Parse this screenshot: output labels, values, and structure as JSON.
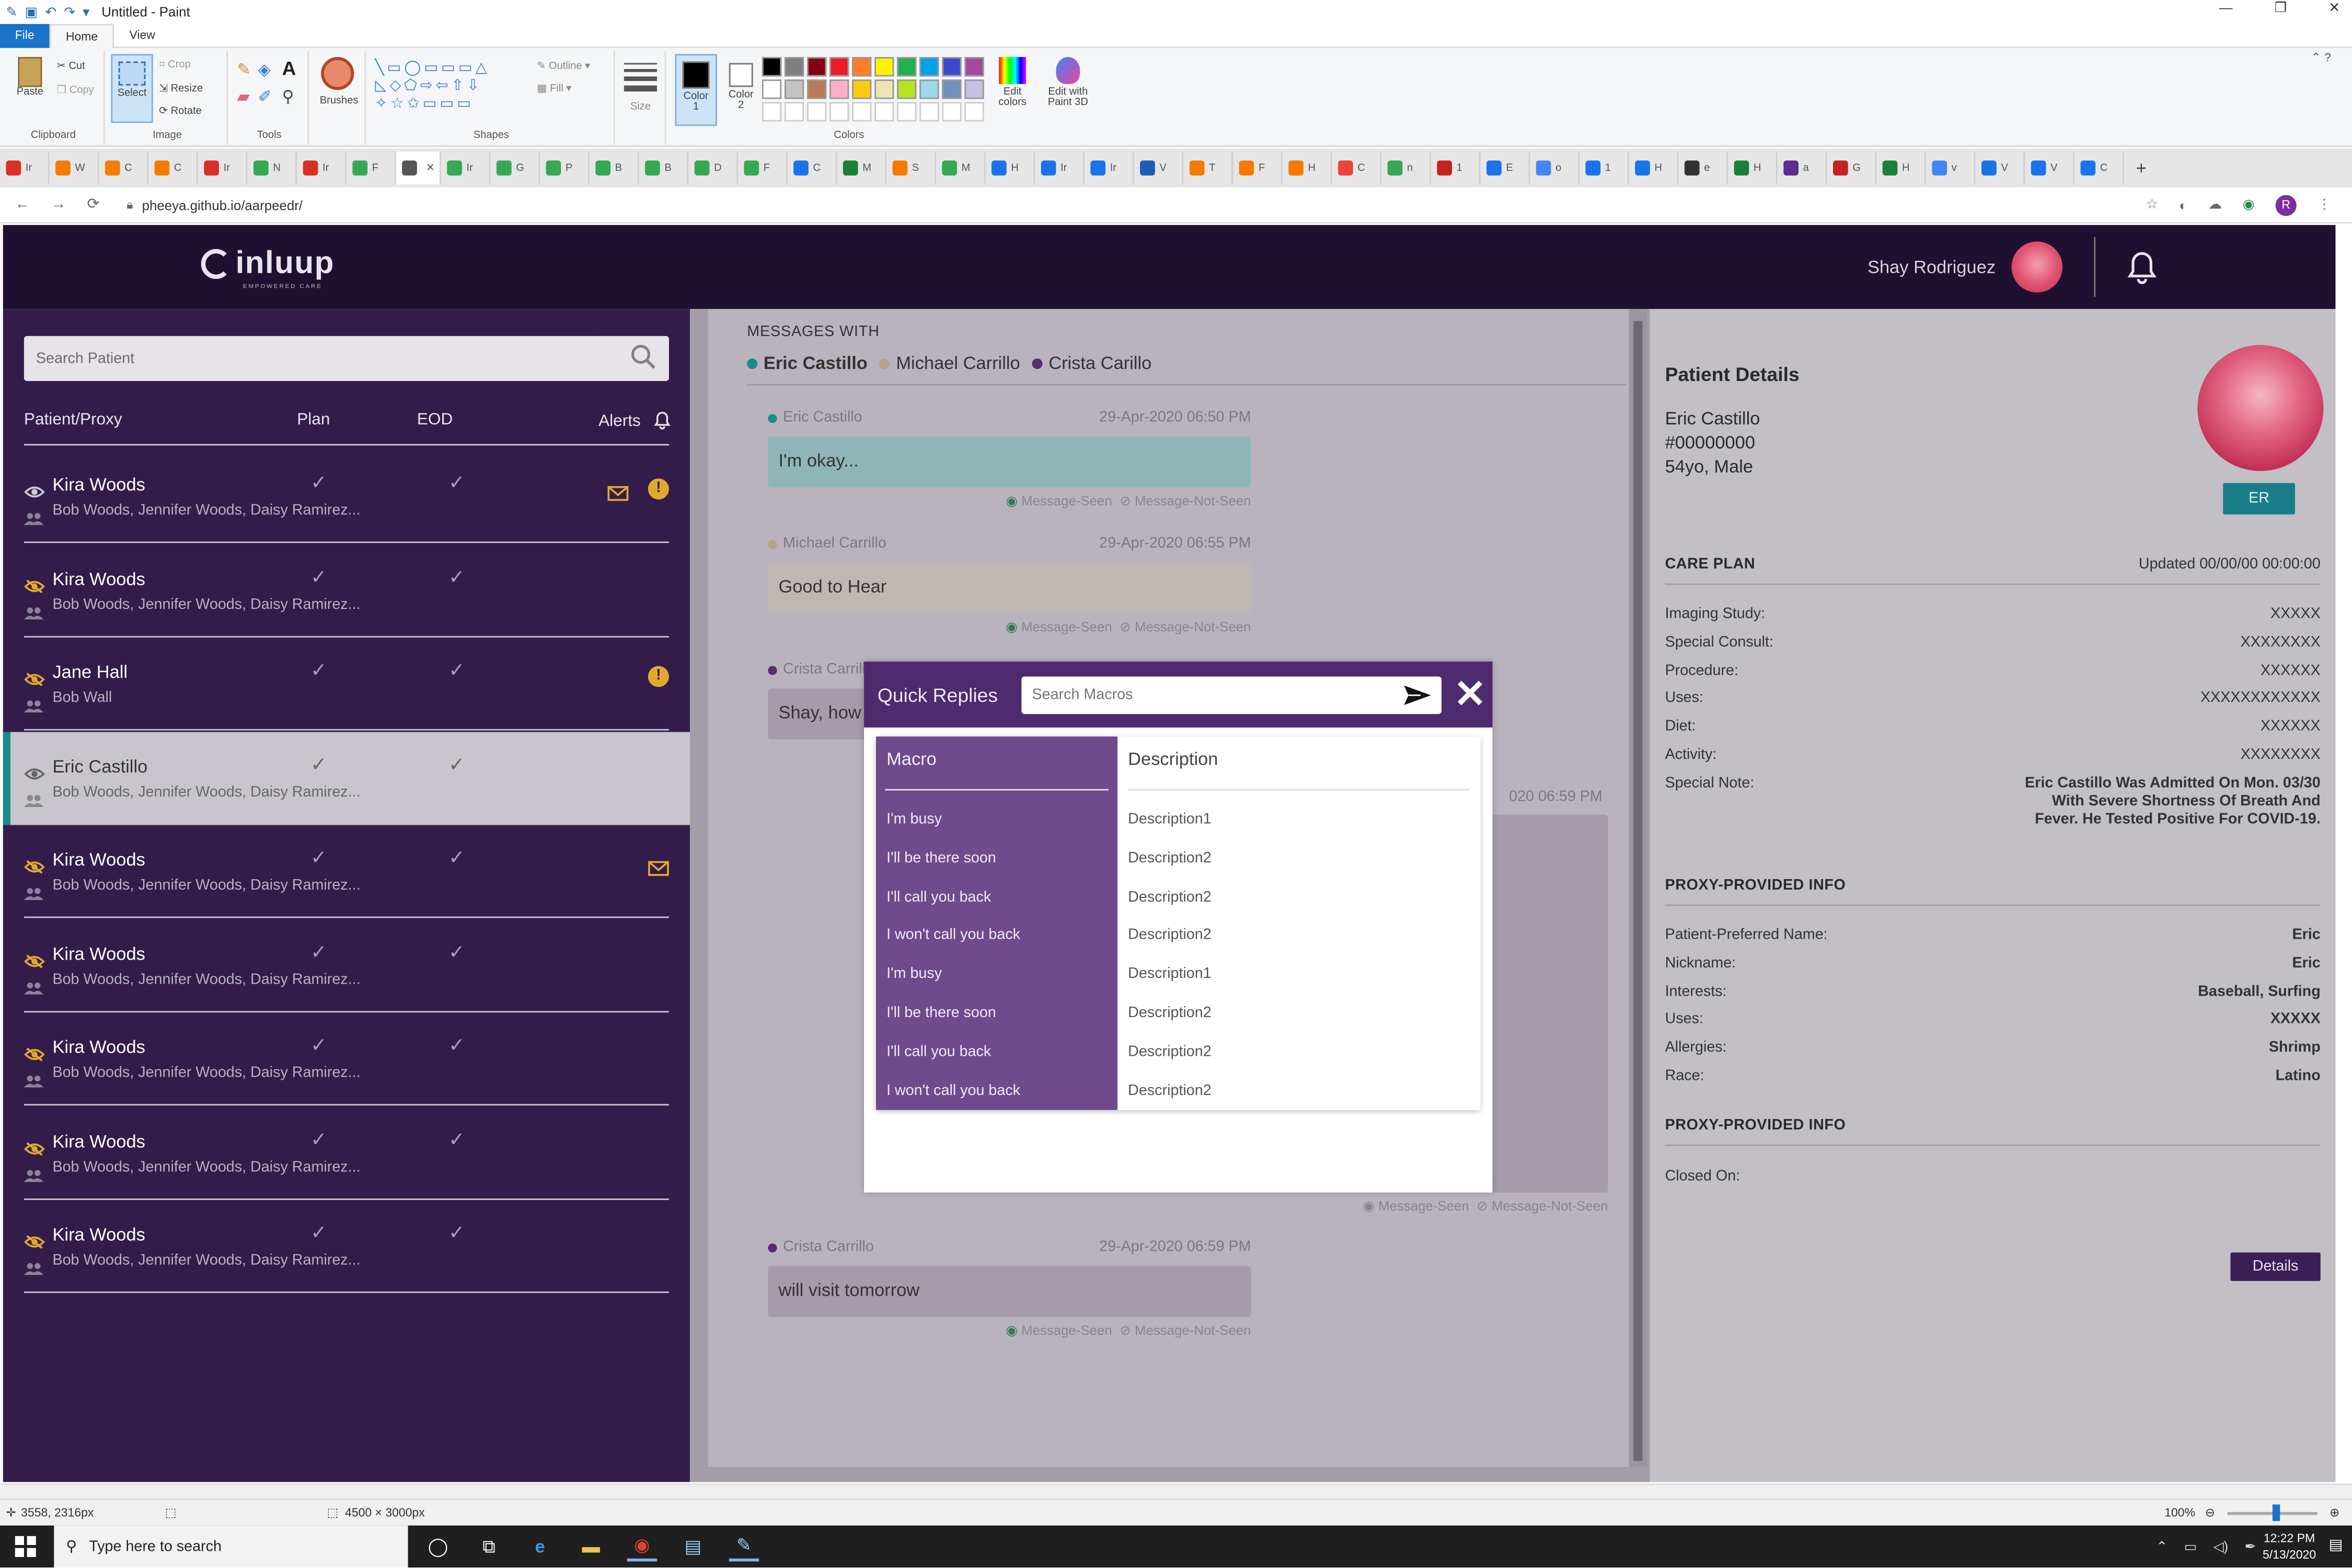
{
  "paint": {
    "window_title": "Untitled - Paint",
    "tabs": [
      "File",
      "Home",
      "View"
    ],
    "groups": {
      "clipboard": {
        "label": "Clipboard",
        "paste": "Paste",
        "cut": "Cut",
        "copy": "Copy"
      },
      "image": {
        "label": "Image",
        "select": "Select",
        "crop": "Crop",
        "resize": "Resize",
        "rotate": "Rotate"
      },
      "tools": {
        "label": "Tools"
      },
      "brushes": {
        "label": "Brushes"
      },
      "shapes": {
        "label": "Shapes",
        "outline": "Outline",
        "fill": "Fill"
      },
      "size": {
        "label": "Size"
      },
      "colors": {
        "label": "Colors",
        "color1": "Color 1",
        "color2": "Color 2",
        "edit_colors": "Edit colors",
        "edit_paint3d": "Edit with Paint 3D"
      }
    },
    "palette": [
      "#000000",
      "#7f7f7f",
      "#880015",
      "#ed1c24",
      "#ff7f27",
      "#fff200",
      "#22b14c",
      "#00a2e8",
      "#3f48cc",
      "#a349a4",
      "#ffffff",
      "#c3c3c3",
      "#b97a57",
      "#ffaec9",
      "#ffc90e",
      "#efe4b0",
      "#b5e61d",
      "#99d9ea",
      "#7092be",
      "#c8bfe7"
    ],
    "status": {
      "cursor": "3558, 2316px",
      "dimensions": "4500 × 3000px",
      "zoom": "100%"
    }
  },
  "browser": {
    "url": "pheeya.github.io/aarpeedr/",
    "profile_initial": "R",
    "tabs": [
      {
        "label": "Ir",
        "color": "#d93025"
      },
      {
        "label": "W",
        "color": "#f57c00"
      },
      {
        "label": "C",
        "color": "#f57c00"
      },
      {
        "label": "C",
        "color": "#f57c00"
      },
      {
        "label": "Ir",
        "color": "#d93025"
      },
      {
        "label": "N",
        "color": "#34a853"
      },
      {
        "label": "Ir",
        "color": "#d93025"
      },
      {
        "label": "F",
        "color": "#34a853"
      },
      {
        "label": "",
        "color": "#555555"
      },
      {
        "label": "Ir",
        "color": "#34a853"
      },
      {
        "label": "G",
        "color": "#34a853"
      },
      {
        "label": "P",
        "color": "#34a853"
      },
      {
        "label": "B",
        "color": "#34a853"
      },
      {
        "label": "B",
        "color": "#34a853"
      },
      {
        "label": "D",
        "color": "#34a853"
      },
      {
        "label": "F",
        "color": "#34a853"
      },
      {
        "label": "C",
        "color": "#1a73e8"
      },
      {
        "label": "M",
        "color": "#188038"
      },
      {
        "label": "S",
        "color": "#f57c00"
      },
      {
        "label": "M",
        "color": "#34a853"
      },
      {
        "label": "H",
        "color": "#1a73e8"
      },
      {
        "label": "Ir",
        "color": "#1a73e8"
      },
      {
        "label": "Ir",
        "color": "#1a73e8"
      },
      {
        "label": "V",
        "color": "#1a5fb4"
      },
      {
        "label": "T",
        "color": "#f57c00"
      },
      {
        "label": "F",
        "color": "#f57c00"
      },
      {
        "label": "H",
        "color": "#f57c00"
      },
      {
        "label": "C",
        "color": "#e8453c"
      },
      {
        "label": "n",
        "color": "#34a853"
      },
      {
        "label": "1",
        "color": "#c5221f"
      },
      {
        "label": "E",
        "color": "#1a73e8"
      },
      {
        "label": "o",
        "color": "#4285f4"
      },
      {
        "label": "1",
        "color": "#1a73e8"
      },
      {
        "label": "H",
        "color": "#1a73e8"
      },
      {
        "label": "e",
        "color": "#333333"
      },
      {
        "label": "H",
        "color": "#188038"
      },
      {
        "label": "a",
        "color": "#5f2b8f"
      },
      {
        "label": "G",
        "color": "#c5221f"
      },
      {
        "label": "H",
        "color": "#188038"
      },
      {
        "label": "v",
        "color": "#4285f4"
      },
      {
        "label": "V",
        "color": "#1a73e8"
      },
      {
        "label": "V",
        "color": "#1a73e8"
      },
      {
        "label": "C",
        "color": "#1a73e8"
      }
    ]
  },
  "app": {
    "logo": "inluup",
    "logo_tagline": "EMPOWERED CARE",
    "user_name": "Shay Rodriguez",
    "search_placeholder": "Search Patient",
    "columns": {
      "patient": "Patient/Proxy",
      "plan": "Plan",
      "eod": "EOD",
      "alerts": "Alerts"
    },
    "patients": [
      {
        "name": "Kira Woods",
        "proxies": "Bob Woods, Jennifer Woods, Daisy Ramirez...",
        "seen": true,
        "mail": true,
        "alert": true,
        "selected": false
      },
      {
        "name": "Kira Woods",
        "proxies": "Bob Woods, Jennifer Woods, Daisy Ramirez...",
        "seen": false,
        "mail": false,
        "alert": false,
        "selected": false
      },
      {
        "name": "Jane Hall",
        "proxies": "Bob Wall",
        "seen": false,
        "mail": false,
        "alert": true,
        "selected": false
      },
      {
        "name": "Eric Castillo",
        "proxies": "Bob Woods, Jennifer Woods, Daisy Ramirez...",
        "seen": true,
        "mail": false,
        "alert": false,
        "selected": true
      },
      {
        "name": "Kira Woods",
        "proxies": "Bob Woods, Jennifer Woods, Daisy Ramirez...",
        "seen": false,
        "mail": true,
        "alert": false,
        "selected": false
      },
      {
        "name": "Kira Woods",
        "proxies": "Bob Woods, Jennifer Woods, Daisy Ramirez...",
        "seen": false,
        "mail": false,
        "alert": false,
        "selected": false
      },
      {
        "name": "Kira Woods",
        "proxies": "Bob Woods, Jennifer Woods, Daisy Ramirez...",
        "seen": false,
        "mail": false,
        "alert": false,
        "selected": false
      },
      {
        "name": "Kira Woods",
        "proxies": "Bob Woods, Jennifer Woods, Daisy Ramirez...",
        "seen": false,
        "mail": false,
        "alert": false,
        "selected": false
      },
      {
        "name": "Kira Woods",
        "proxies": "Bob Woods, Jennifer Woods, Daisy Ramirez...",
        "seen": false,
        "mail": false,
        "alert": false,
        "selected": false
      }
    ],
    "messages": {
      "heading": "MESSAGES WITH",
      "participants": [
        {
          "name": "Eric Castillo",
          "color": "#1a8c8c"
        },
        {
          "name": "Michael Carrillo",
          "color": "#b4a587"
        },
        {
          "name": "Crista Carillo",
          "color": "#5a2b70"
        }
      ],
      "seen_label": "Message-Seen",
      "not_seen_label": "Message-Not-Seen",
      "items": [
        {
          "sender": "Eric Castillo",
          "time": "29-Apr-2020 06:50 PM",
          "text": "I'm okay...",
          "dot": "#1a8c8c",
          "bubble": "#8fb5b8"
        },
        {
          "sender": "Michael Carrillo",
          "time": "29-Apr-2020 06:55 PM",
          "text": "Good to Hear",
          "dot": "#b4a587",
          "bubble": "#bfb7b4"
        },
        {
          "sender": "Crista Carrillo",
          "time": "",
          "text": "Shay, how is",
          "dot": "#5a2b70",
          "bubble": "#a59ba9"
        },
        {
          "sender": "Crista Carrillo",
          "time": "29-Apr-2020 06:59 PM",
          "text": "will visit tomorrow",
          "dot": "#5a2b70",
          "bubble": "#a59ba9"
        }
      ],
      "hidden_time": "020 06:59 PM"
    },
    "details": {
      "title": "Patient Details",
      "name": "Eric Castillo",
      "mrn": "#00000000",
      "demo": "54yo, Male",
      "badge": "ER",
      "care_plan_head": "CARE PLAN",
      "care_plan_updated": "Updated 00/00/00 00:00:00",
      "care_plan": [
        {
          "k": "Imaging Study:",
          "v": "XXXXX"
        },
        {
          "k": "Special Consult:",
          "v": "XXXXXXXX"
        },
        {
          "k": "Procedure:",
          "v": "XXXXXX"
        },
        {
          "k": "Uses:",
          "v": "XXXXXXXXXXXX"
        },
        {
          "k": "Diet:",
          "v": "XXXXXX"
        },
        {
          "k": "Activity:",
          "v": "XXXXXXXX"
        }
      ],
      "special_note_label": "Special Note:",
      "special_note": "Eric Castillo Was Admitted On Mon. 03/30 With Severe Shortness Of Breath And Fever. He Tested Positive For COVID-19.",
      "proxy_head": "PROXY-PROVIDED INFO",
      "proxy_info": [
        {
          "k": "Patient-Preferred Name:",
          "v": "Eric"
        },
        {
          "k": "Nickname:",
          "v": "Eric"
        },
        {
          "k": "Interests:",
          "v": "Baseball, Surfing"
        },
        {
          "k": "Uses:",
          "v": "XXXXX"
        },
        {
          "k": "Allergies:",
          "v": "Shrimp"
        },
        {
          "k": "Race:",
          "v": "Latino"
        }
      ],
      "proxy_head2": "PROXY-PROVIDED INFO",
      "closed_on_label": "Closed On:",
      "details_btn": "Details"
    },
    "quick_replies": {
      "title": "Quick Replies",
      "search_placeholder": "Search Macros",
      "col_macro": "Macro",
      "col_desc": "Description",
      "rows": [
        {
          "macro": "I'm busy",
          "desc": "Description1"
        },
        {
          "macro": "I'll be there soon",
          "desc": "Description2"
        },
        {
          "macro": "I'll call you back",
          "desc": "Description2"
        },
        {
          "macro": "I won't call you back",
          "desc": "Description2"
        },
        {
          "macro": "I'm busy",
          "desc": "Description1"
        },
        {
          "macro": "I'll be there soon",
          "desc": "Description2"
        },
        {
          "macro": "I'll call you back",
          "desc": "Description2"
        },
        {
          "macro": "I won't call you back",
          "desc": "Description2"
        }
      ]
    }
  },
  "taskbar": {
    "search_placeholder": "Type here to search",
    "time": "12:22 PM",
    "date": "5/13/2020"
  }
}
